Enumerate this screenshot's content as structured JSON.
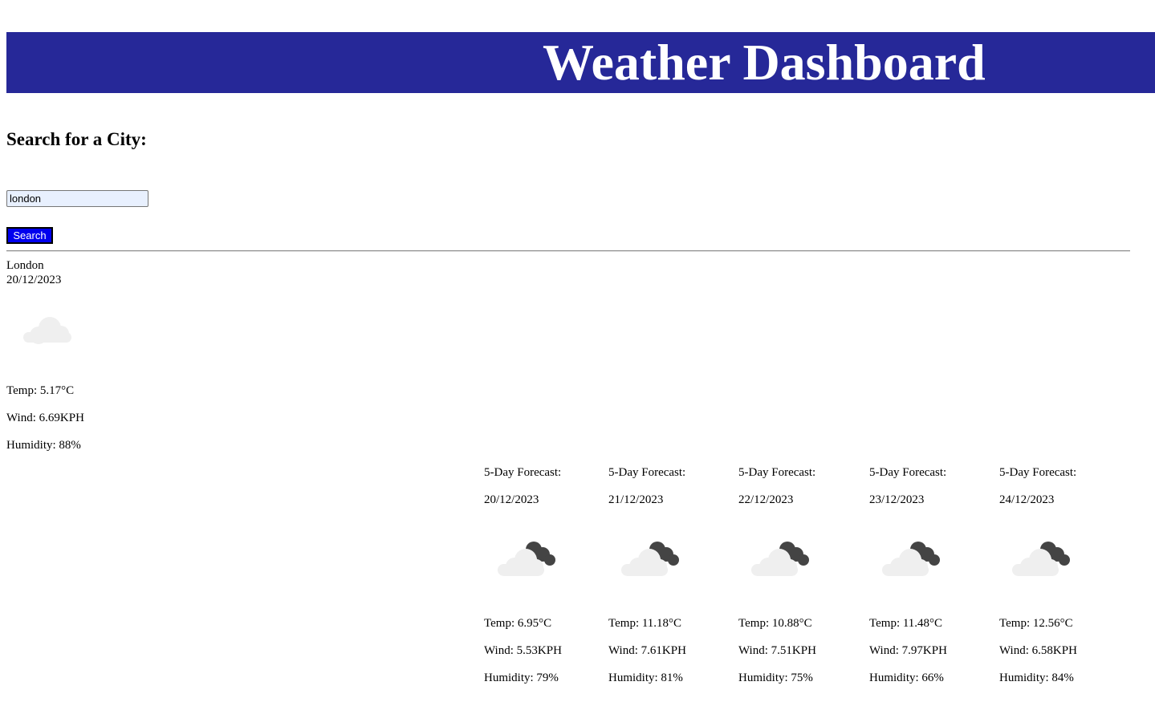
{
  "header": {
    "title": "Weather Dashboard",
    "background_color": "#262898"
  },
  "search": {
    "heading": "Search for a City:",
    "input_value": "london",
    "button_label": "Search",
    "button_color": "#0000ee"
  },
  "current": {
    "city": "London",
    "date": "20/12/2023",
    "icon": "cloud-icon",
    "temp": "Temp: 5.17°C",
    "wind": "Wind: 6.69KPH",
    "humidity": "Humidity: 88%"
  },
  "forecast": [
    {
      "heading": "5-Day Forecast:",
      "date": "20/12/2023",
      "icon": "cloud-dark-cloud-icon",
      "temp": "Temp: 6.95°C",
      "wind": "Wind: 5.53KPH",
      "humidity": "Humidity: 79%"
    },
    {
      "heading": "5-Day Forecast:",
      "date": "21/12/2023",
      "icon": "cloud-dark-cloud-icon",
      "temp": "Temp: 11.18°C",
      "wind": "Wind: 7.61KPH",
      "humidity": "Humidity: 81%"
    },
    {
      "heading": "5-Day Forecast:",
      "date": "22/12/2023",
      "icon": "cloud-dark-cloud-icon",
      "temp": "Temp: 10.88°C",
      "wind": "Wind: 7.51KPH",
      "humidity": "Humidity: 75%"
    },
    {
      "heading": "5-Day Forecast:",
      "date": "23/12/2023",
      "icon": "cloud-dark-cloud-icon",
      "temp": "Temp: 11.48°C",
      "wind": "Wind: 7.97KPH",
      "humidity": "Humidity: 66%"
    },
    {
      "heading": "5-Day Forecast:",
      "date": "24/12/2023",
      "icon": "cloud-dark-cloud-icon",
      "temp": "Temp: 12.56°C",
      "wind": "Wind: 6.58KPH",
      "humidity": "Humidity: 84%"
    }
  ]
}
